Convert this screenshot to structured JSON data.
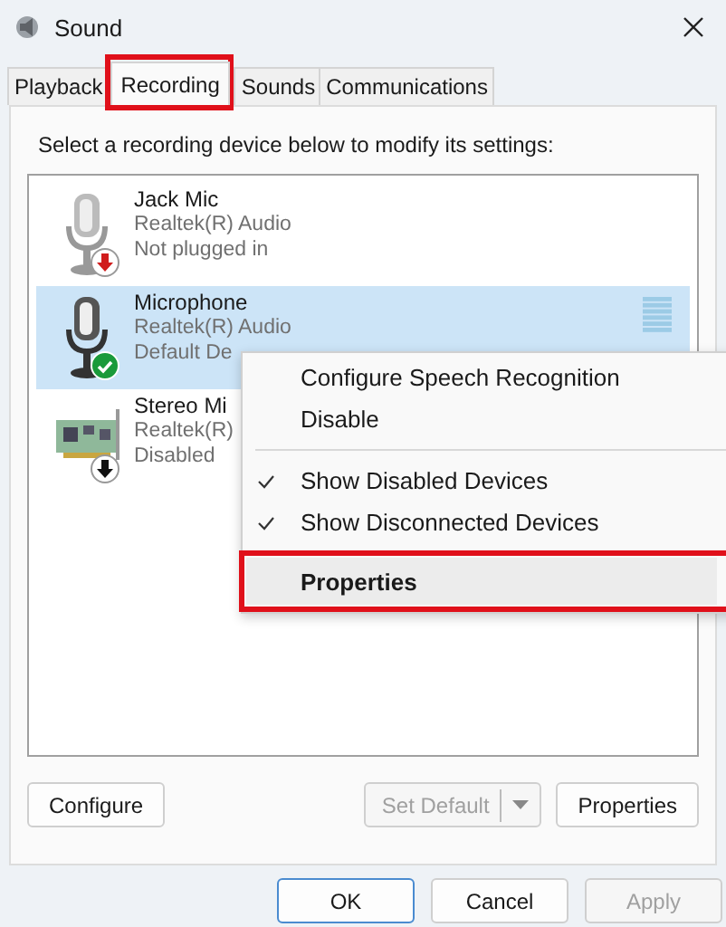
{
  "window": {
    "title": "Sound"
  },
  "tabs": [
    {
      "label": "Playback",
      "selected": false,
      "highlighted": false
    },
    {
      "label": "Recording",
      "selected": true,
      "highlighted": true
    },
    {
      "label": "Sounds",
      "selected": false,
      "highlighted": false
    },
    {
      "label": "Communications",
      "selected": false,
      "highlighted": false
    }
  ],
  "instruction": "Select a recording device below to modify its settings:",
  "devices": [
    {
      "kind": "mic_unplugged",
      "name": "Jack Mic",
      "driver": "Realtek(R) Audio",
      "status": "Not plugged in",
      "selected": false
    },
    {
      "kind": "mic_default",
      "name": "Microphone",
      "driver": "Realtek(R) Audio",
      "status": "Default De",
      "selected": true
    },
    {
      "kind": "card_disabled",
      "name": "Stereo Mi",
      "driver": "Realtek(R)",
      "status": "Disabled",
      "selected": false
    }
  ],
  "context_menu": {
    "items": [
      {
        "kind": "item",
        "label": "Configure Speech Recognition",
        "checked": false,
        "default": false,
        "highlighted": false
      },
      {
        "kind": "item",
        "label": "Disable",
        "checked": false,
        "default": false,
        "highlighted": false
      },
      {
        "kind": "separator"
      },
      {
        "kind": "item",
        "label": "Show Disabled Devices",
        "checked": true,
        "default": false,
        "highlighted": false
      },
      {
        "kind": "item",
        "label": "Show Disconnected Devices",
        "checked": true,
        "default": false,
        "highlighted": false
      },
      {
        "kind": "item",
        "label": "Properties",
        "checked": false,
        "default": true,
        "highlighted": true
      }
    ]
  },
  "panel_buttons": [
    {
      "kind": "plain",
      "label": "Configure",
      "disabled": false
    },
    {
      "kind": "split",
      "label": "Set Default",
      "disabled": true
    },
    {
      "kind": "plain",
      "label": "Properties",
      "disabled": false
    }
  ],
  "dialog_buttons": [
    {
      "label": "OK",
      "default": true,
      "disabled": false
    },
    {
      "label": "Cancel",
      "default": false,
      "disabled": false
    },
    {
      "label": "Apply",
      "default": false,
      "disabled": true
    }
  ]
}
